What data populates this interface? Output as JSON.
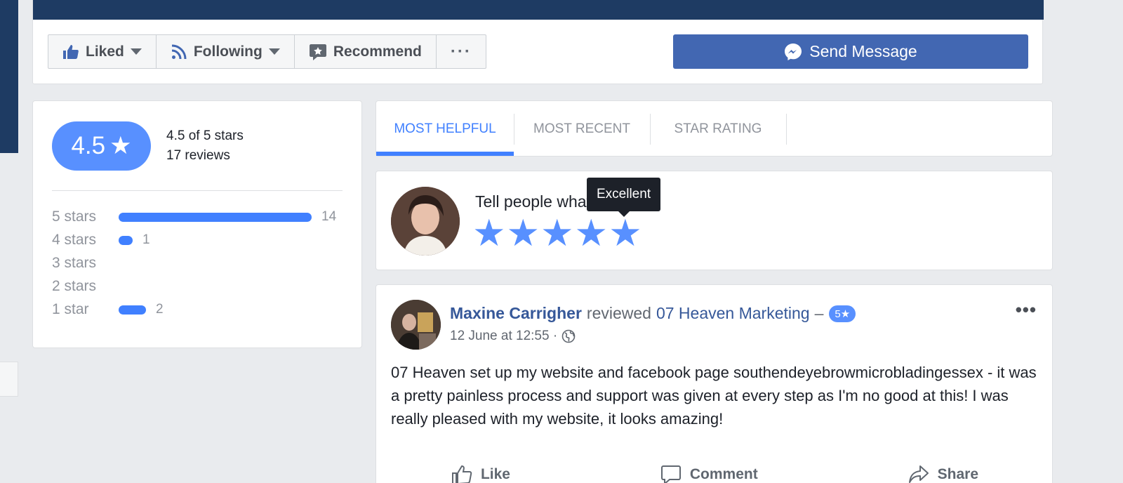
{
  "page_actions": {
    "liked_label": "Liked",
    "following_label": "Following",
    "recommend_label": "Recommend",
    "more_label": "···",
    "send_message_label": "Send Message"
  },
  "rating_summary": {
    "score": "4.5",
    "star_glyph": "★",
    "of_stars": "4.5 of 5 stars",
    "reviews_count": "17 reviews",
    "breakdown": [
      {
        "label": "5 stars",
        "count": "14",
        "fraction": 1.0
      },
      {
        "label": "4 stars",
        "count": "1",
        "fraction": 0.071
      },
      {
        "label": "3 stars",
        "count": "",
        "fraction": 0
      },
      {
        "label": "2 stars",
        "count": "",
        "fraction": 0
      },
      {
        "label": "1 star",
        "count": "2",
        "fraction": 0.143
      }
    ]
  },
  "tabs": [
    {
      "label": "MOST HELPFUL",
      "active": true
    },
    {
      "label": "MOST RECENT",
      "active": false
    },
    {
      "label": "STAR RATING",
      "active": false
    }
  ],
  "compose": {
    "prompt": "Tell people what you think",
    "tooltip": "Excellent",
    "selected_stars": 5
  },
  "review": {
    "author": "Maxine Carrigher",
    "verb": "reviewed",
    "page_name": "07 Heaven Marketing",
    "dash": "–",
    "badge": "5★",
    "date": "12 June at 12:55 ·",
    "more": "•••",
    "body": "07 Heaven set up my website and facebook page southendeyebrowmicrobladingessex - it was a pretty painless process and support was given at every step as I'm no good at this! I was really pleased with my website, it looks amazing!",
    "actions": {
      "like": "Like",
      "comment": "Comment",
      "share": "Share"
    }
  },
  "colors": {
    "brand_blue": "#4267b2",
    "accent_blue": "#4080ff",
    "cover_navy": "#1e3b63",
    "link_blue": "#365899"
  }
}
